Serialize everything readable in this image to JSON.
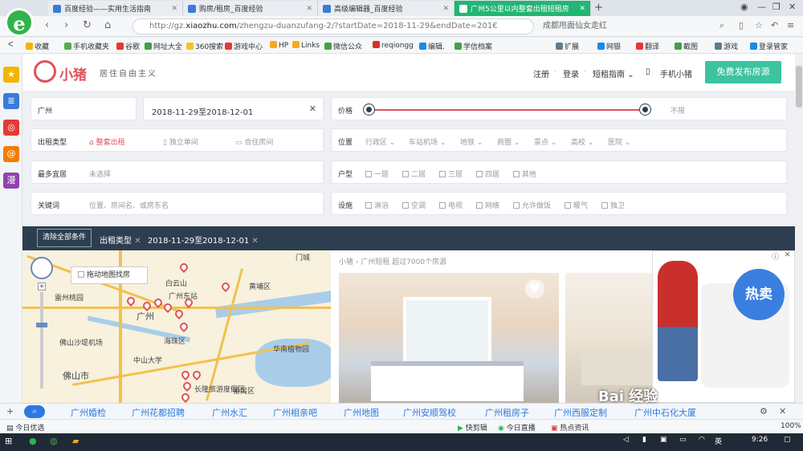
{
  "tabs": [
    {
      "title": "百度经验——实用生活指南",
      "active": false
    },
    {
      "title": "购房/租房_百度经验",
      "active": false
    },
    {
      "title": "高级编辑器_百度经验",
      "active": false
    },
    {
      "title": "广州5公里以内整套出租短租房",
      "active": true
    }
  ],
  "address": {
    "prefix": "http://gz.",
    "host": "xiaozhu.com",
    "path": "/zhengzu-duanzufang-2/?startDate=2018-11-29&endDate=201€",
    "search": "成都甩面仙女走红"
  },
  "bookmarks": [
    "收藏",
    "手机收藏夹",
    "谷歌",
    "网址大全",
    "360搜索",
    "游戏中心",
    "HP",
    "Links",
    "微信公众",
    "reqiongg",
    "编辑.",
    "学信档案",
    "扩展",
    "网银",
    "翻译",
    "截图",
    "游戏",
    "登录管家"
  ],
  "site": {
    "brand": "小猪",
    "slogan": "居住自由主义",
    "nav": [
      "注册",
      "登录",
      "短租指南",
      "手机小猪"
    ],
    "publish": "免费发布房源"
  },
  "filters": {
    "city": "广州",
    "dates": "2018-11-29至2018-12-01",
    "price_label": "价格",
    "price_max": "不限",
    "type_label": "出租类型",
    "types": [
      "整套出租",
      "独立单间",
      "合住房间"
    ],
    "location_label": "位置",
    "locations": [
      "行政区",
      "车站机场",
      "地铁",
      "商圈",
      "景点",
      "高校",
      "医院"
    ],
    "guests_label": "最多宜居",
    "guests_value": "未选择",
    "layout_label": "户型",
    "layouts": [
      "一居",
      "二居",
      "三居",
      "四居",
      "其他"
    ],
    "keyword_label": "关键词",
    "keyword_placeholder": "位置、房间名、或房东名",
    "facility_label": "设施",
    "facilities": [
      "淋浴",
      "空调",
      "电视",
      "网络",
      "允许做饭",
      "暖气",
      "独卫"
    ]
  },
  "tagbar": {
    "clear": "清除全部条件",
    "tags": [
      "出租类型",
      "2018-11-29至2018-12-01"
    ]
  },
  "map": {
    "checkbox": "拖动地图找房",
    "labels": [
      "白云山",
      "广州东站",
      "黄埔区",
      "海珠区",
      "佛山沙堤机场",
      "佛山市",
      "番禺区",
      "雷州桃园",
      "广州",
      "华南植物园",
      "中山大学",
      "门城",
      "长隆旅游度假区"
    ]
  },
  "listing": {
    "crumb": "小猪 › 广州短租   超过7000个房源"
  },
  "ad": {
    "hot": "热卖"
  },
  "watermark": "Bai 经验",
  "baidu_bar": [
    "广州婚检",
    "广州花都招聘",
    "广州水汇",
    "广州相亲吧",
    "广州地图",
    "广州安顺驾校",
    "广州租房子",
    "广州西服定制",
    "广州中石化大厦"
  ],
  "statusbar": {
    "left": "今日优选",
    "items": [
      "快剪辑",
      "今日直播",
      "热点资讯"
    ],
    "zoom": "100%"
  },
  "taskbar": {
    "ime": "英",
    "time": "9:26"
  }
}
